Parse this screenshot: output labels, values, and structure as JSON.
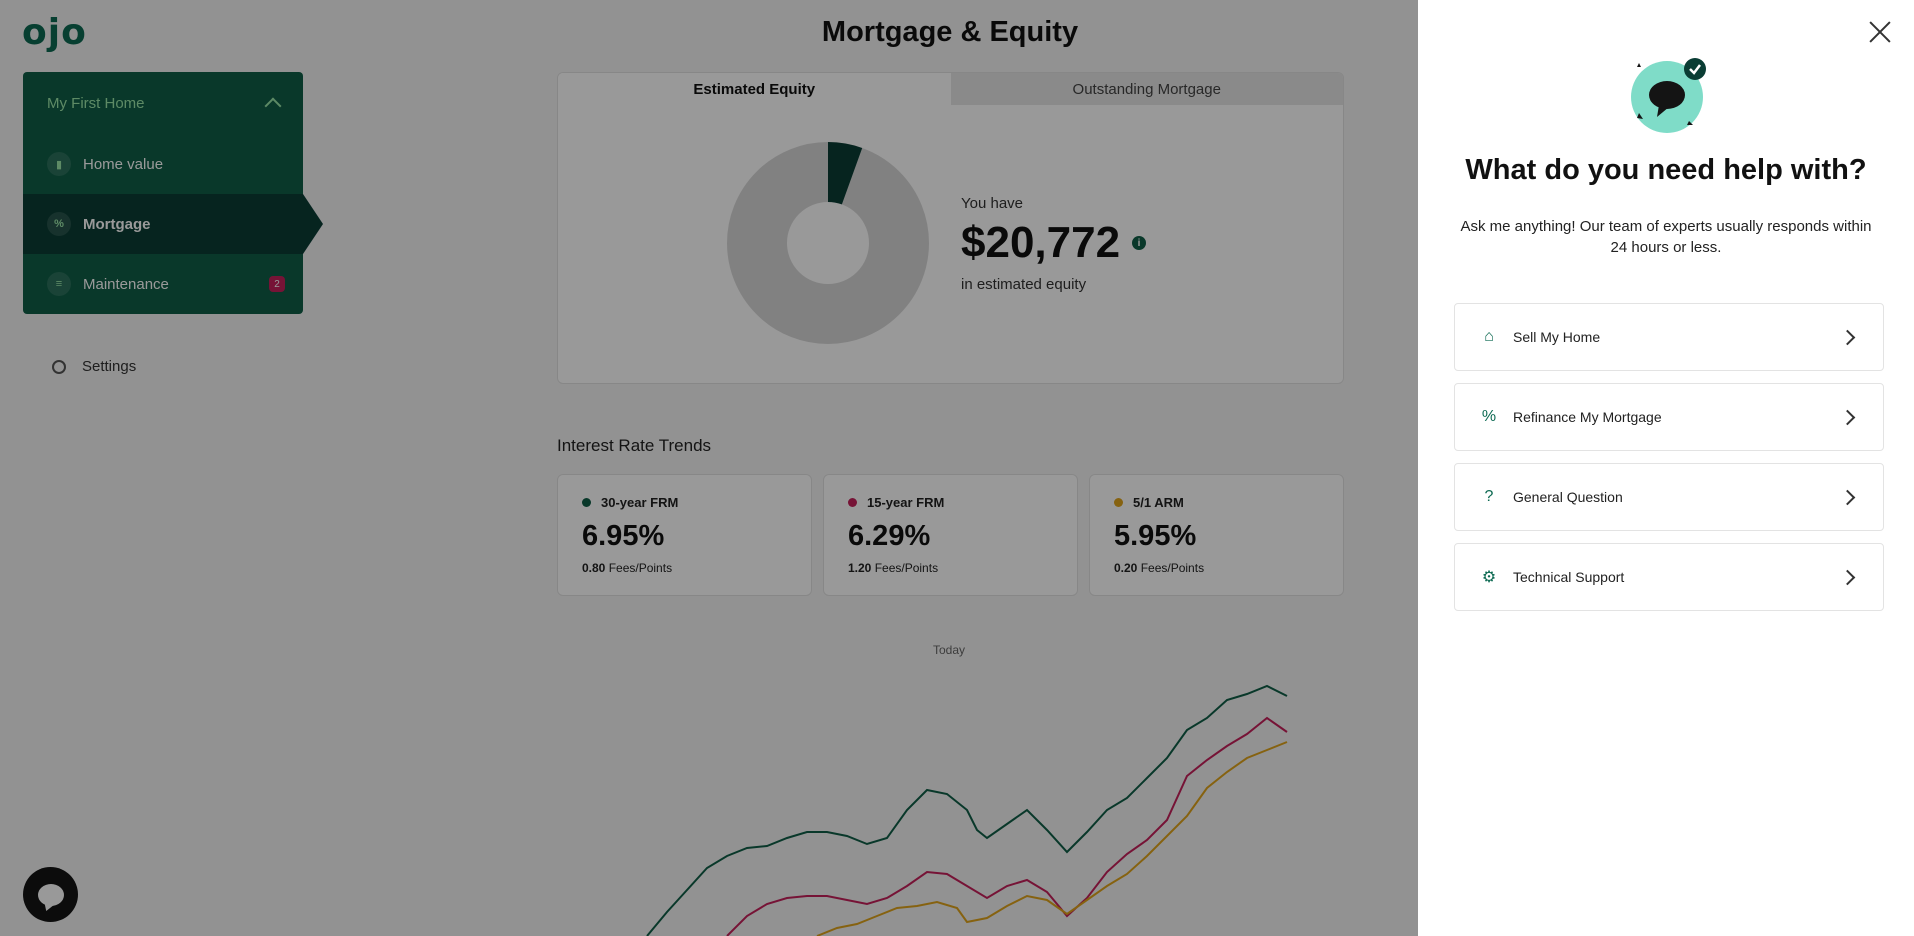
{
  "app": {
    "logo": "ojo",
    "page_title": "Mortgage & Equity"
  },
  "nav": {
    "home_name": "My First Home",
    "items": [
      {
        "label": "Home value",
        "icon": "bar-chart-icon"
      },
      {
        "label": "Mortgage",
        "icon": "percent-icon",
        "active": true
      },
      {
        "label": "Maintenance",
        "icon": "list-icon",
        "badge": "2"
      }
    ],
    "settings_label": "Settings"
  },
  "equity": {
    "tabs": [
      "Estimated Equity",
      "Outstanding Mortgage"
    ],
    "you_have": "You have",
    "amount": "$20,772",
    "info_icon": "i",
    "caption": "in estimated equity",
    "equity_fraction": 0.055
  },
  "trends": {
    "title": "Interest Rate Trends",
    "fees_label": "Fees/Points",
    "rates": [
      {
        "name": "30-year FRM",
        "value": "6.95%",
        "fees": "0.80",
        "color": "#0f5e46"
      },
      {
        "name": "15-year FRM",
        "value": "6.29%",
        "fees": "1.20",
        "color": "#c5205a"
      },
      {
        "name": "5/1 ARM",
        "value": "5.95%",
        "fees": "0.20",
        "color": "#e0a41c"
      }
    ],
    "today_label": "Today"
  },
  "colors": {
    "brand": "#0f5e46",
    "brand_dark": "#0a3d34",
    "accent": "#9ce6a9"
  },
  "panel": {
    "title": "What do you need help with?",
    "subtitle": "Ask me anything! Our team of experts usually responds within 24 hours or less.",
    "options": [
      {
        "label": "Sell My Home",
        "icon": "house-icon"
      },
      {
        "label": "Refinance My Mortgage",
        "icon": "percent-icon"
      },
      {
        "label": "General Question",
        "icon": "question-icon"
      },
      {
        "label": "Technical Support",
        "icon": "gear-icon"
      }
    ]
  }
}
